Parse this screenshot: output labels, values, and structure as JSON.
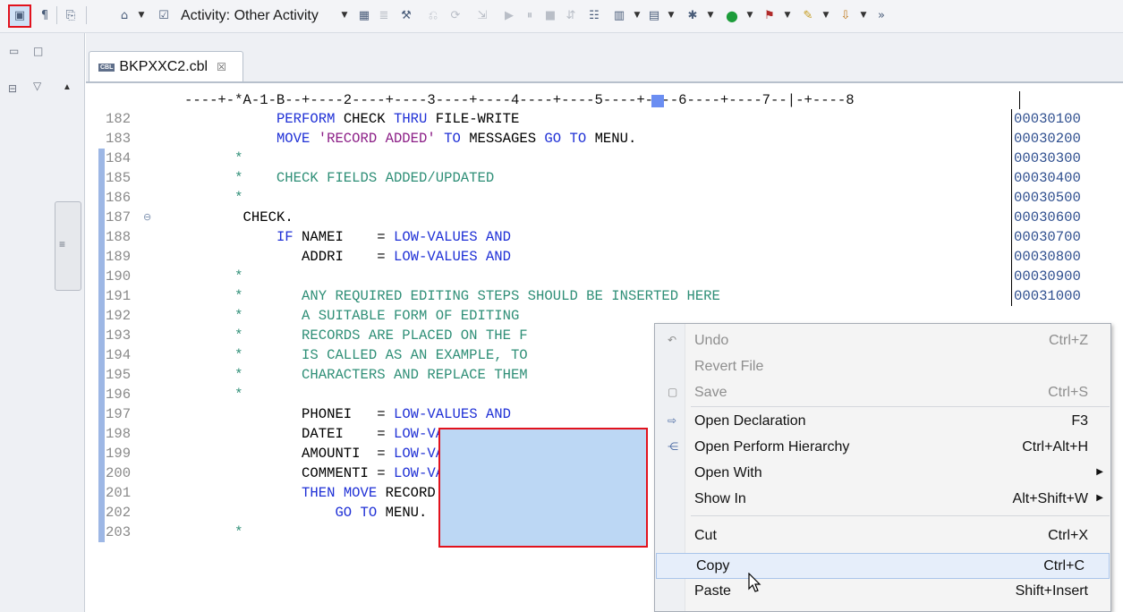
{
  "toolbar": {
    "activity_label": "Activity: Other Activity",
    "highlight_color": "#e2121d"
  },
  "editor": {
    "tab_icon_text": "CBL",
    "tab_title": "BKPXXC2.cbl",
    "tab_close": "☒",
    "ruler": "----+-*A-1-B--+----2----+----3----+----4----+----5----+----6----+----7--|-+----8",
    "lines": [
      {
        "num": "182",
        "code": "           PERFORM CHECK THRU FILE-WRITE",
        "seq": "00030100"
      },
      {
        "num": "183",
        "code": "           MOVE 'RECORD ADDED' TO MESSAGES GO TO MENU.",
        "seq": "00030200"
      },
      {
        "num": "184",
        "code": "      *",
        "seq": "00030300"
      },
      {
        "num": "185",
        "code": "      *    CHECK FIELDS ADDED/UPDATED",
        "seq": "00030400"
      },
      {
        "num": "186",
        "code": "      *",
        "seq": "00030500"
      },
      {
        "num": "187",
        "code": "       CHECK.",
        "seq": "00030600"
      },
      {
        "num": "188",
        "code": "           IF NAMEI    = LOW-VALUES AND",
        "seq": "00030700"
      },
      {
        "num": "189",
        "code": "              ADDRI    = LOW-VALUES AND",
        "seq": "00030800"
      },
      {
        "num": "190",
        "code": "      *",
        "seq": "00030900"
      },
      {
        "num": "191",
        "code": "      *       ANY REQUIRED EDITING STEPS SHOULD BE INSERTED HERE",
        "seq": "00031000"
      },
      {
        "num": "192",
        "code": "      *       A SUITABLE FORM OF EDITING",
        "seq": ""
      },
      {
        "num": "193",
        "code": "      *       RECORDS ARE PLACED ON THE F",
        "seq": ""
      },
      {
        "num": "194",
        "code": "      *       IS CALLED AS AN EXAMPLE, TO",
        "seq": ""
      },
      {
        "num": "195",
        "code": "      *       CHARACTERS AND REPLACE THEM",
        "seq": ""
      },
      {
        "num": "196",
        "code": "      *",
        "seq": ""
      },
      {
        "num": "197",
        "code": "              PHONEI   = LOW-VALUES AND",
        "seq": ""
      },
      {
        "num": "198",
        "code": "              DATEI    = LOW-VALUES AND",
        "seq": ""
      },
      {
        "num": "199",
        "code": "              AMOUNTI  = LOW-VALUES AND",
        "seq": ""
      },
      {
        "num": "200",
        "code": "              COMMENTI = LOW-VALUES",
        "seq": ""
      },
      {
        "num": "201",
        "code": "              THEN MOVE 'RECORD NOT MODIF",
        "seq": ""
      },
      {
        "num": "202",
        "code": "                  GO TO MENU.",
        "seq": ""
      },
      {
        "num": "203",
        "code": "      *",
        "seq": ""
      }
    ]
  },
  "context_menu": {
    "items": [
      {
        "label": "Undo",
        "accel": "Ctrl+Z",
        "icon": "undo-icon",
        "disabled": true
      },
      {
        "label": "Revert File",
        "accel": "",
        "icon": "",
        "disabled": true
      },
      {
        "label": "Save",
        "accel": "Ctrl+S",
        "icon": "save-icon",
        "disabled": true
      },
      {
        "label": "Open Declaration",
        "accel": "F3",
        "icon": "open-declaration-icon"
      },
      {
        "label": "Open Perform Hierarchy",
        "accel": "Ctrl+Alt+H",
        "icon": "hierarchy-icon"
      },
      {
        "label": "Open With",
        "accel": "",
        "icon": "",
        "submenu": true
      },
      {
        "label": "Show In",
        "accel": "Alt+Shift+W",
        "icon": "",
        "submenu": true
      },
      {
        "label": "Cut",
        "accel": "Ctrl+X",
        "icon": ""
      },
      {
        "label": "Copy",
        "accel": "Ctrl+C",
        "icon": "",
        "hover": true
      },
      {
        "label": "Paste",
        "accel": "Shift+Insert",
        "icon": ""
      }
    ]
  }
}
